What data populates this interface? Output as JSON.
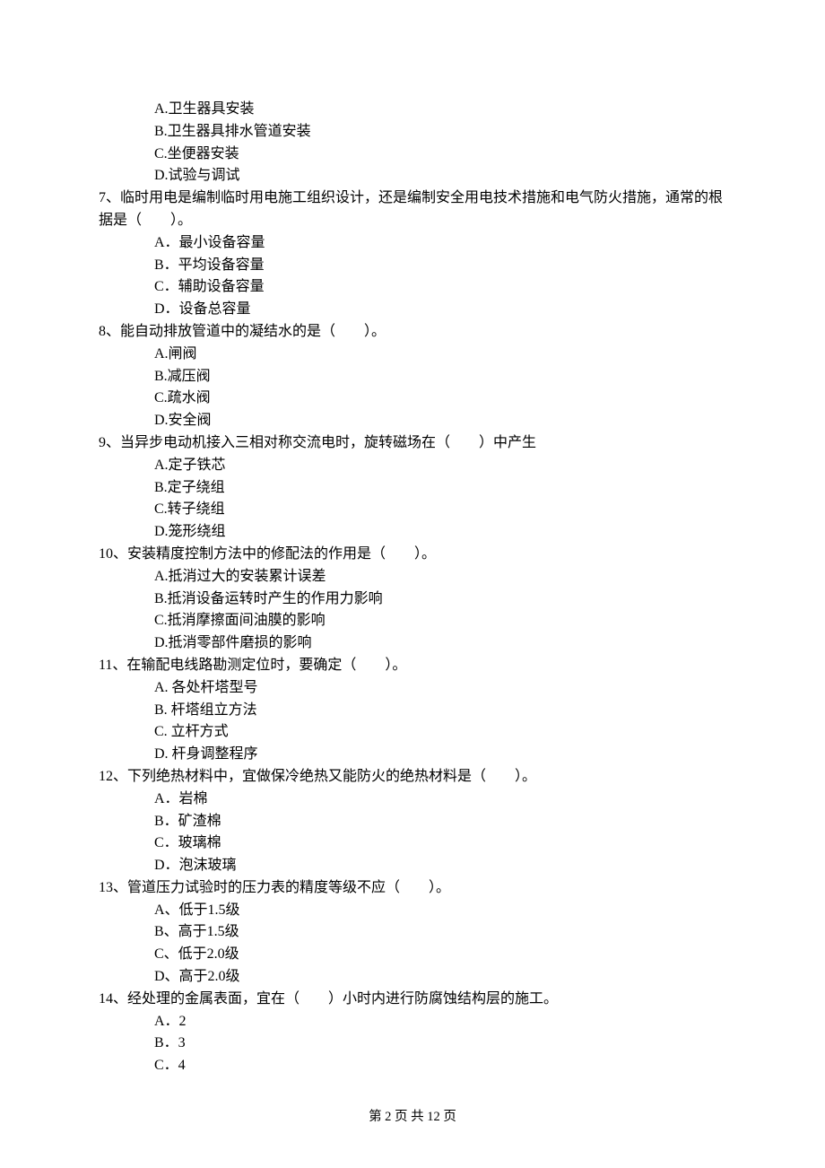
{
  "initialOptions": [
    "A.卫生器具安装",
    "B.卫生器具排水管道安装",
    "C.坐便器安装",
    "D.试验与调试"
  ],
  "questions": [
    {
      "text": "7、临时用电是编制临时用电施工组织设计，还是编制安全用电技术措施和电气防火措施，通常的根据是（　　）。",
      "options": [
        "A．最小设备容量",
        "B．平均设备容量",
        "C．辅助设备容量",
        "D．设备总容量"
      ]
    },
    {
      "text": "8、能自动排放管道中的凝结水的是（　　）。",
      "options": [
        "A.闸阀",
        "B.减压阀",
        "C.疏水阀",
        "D.安全阀"
      ]
    },
    {
      "text": "9、当异步电动机接入三相对称交流电时，旋转磁场在（　　）中产生",
      "options": [
        "A.定子铁芯",
        "B.定子绕组",
        "C.转子绕组",
        "D.笼形绕组"
      ]
    },
    {
      "text": "10、安装精度控制方法中的修配法的作用是（　　）。",
      "options": [
        "A.抵消过大的安装累计误差",
        "B.抵消设备运转时产生的作用力影响",
        "C.抵消摩擦面间油膜的影响",
        "D.抵消零部件磨损的影响"
      ]
    },
    {
      "text": "11、在输配电线路勘测定位时，要确定（　　）。",
      "options": [
        "A. 各处杆塔型号",
        "B. 杆塔组立方法",
        "C. 立杆方式",
        "D. 杆身调整程序"
      ]
    },
    {
      "text": "12、下列绝热材料中，宜做保冷绝热又能防火的绝热材料是（　　）。",
      "options": [
        "A．岩棉",
        "B．矿渣棉",
        "C．玻璃棉",
        "D．泡沫玻璃"
      ]
    },
    {
      "text": "13、管道压力试验时的压力表的精度等级不应（　　）。",
      "options": [
        "A、低于1.5级",
        "B、高于1.5级",
        "C、低于2.0级",
        "D、高于2.0级"
      ]
    },
    {
      "text": "14、经处理的金属表面，宜在（　　）小时内进行防腐蚀结构层的施工。",
      "options": [
        "A．2",
        "B．3",
        "C．4"
      ]
    }
  ],
  "footer": "第 2 页 共 12 页"
}
